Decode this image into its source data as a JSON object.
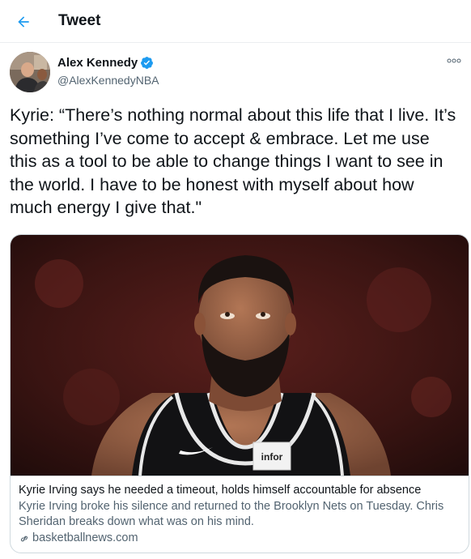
{
  "header": {
    "title": "Tweet",
    "back_icon": "arrow-left-icon"
  },
  "author": {
    "display_name": "Alex Kennedy",
    "handle": "@AlexKennedyNBA",
    "verified": true
  },
  "tweet": {
    "text": "Kyrie: “There’s nothing normal about this life that I live. It’s\nsomething I’ve come to accept & embrace. Let me use\nthis as a tool to be able to change things I want to see in\nthe world. I have to be honest with myself about how\nmuch energy I give that.\""
  },
  "card": {
    "title": "Kyrie Irving says he needed a timeout, holds himself accountable for absence",
    "description": "Kyrie Irving broke his silence and returned to the Brooklyn Nets on Tuesday. Chris Sheridan breaks down what was on his mind.",
    "domain": "basketballnews.com",
    "jersey_patch_text": "infor"
  },
  "colors": {
    "accent": "#1d9bf0",
    "text_primary": "#0f1419",
    "text_secondary": "#536471",
    "border": "#cfd9de"
  }
}
